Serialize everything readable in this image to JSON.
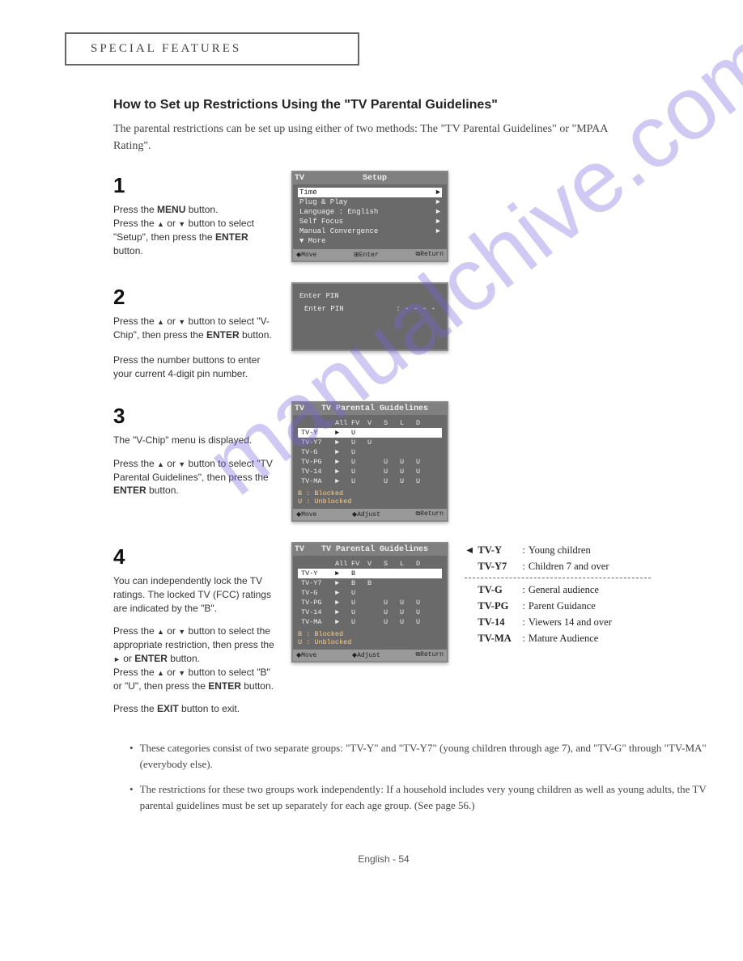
{
  "watermark": "manualchive.com",
  "section_header": "SPECIAL FEATURES",
  "main_title": "How to Set up Restrictions Using the \"TV Parental Guidelines\"",
  "intro_text": "The parental restrictions can be set up using either of two methods: The \"TV Parental Guidelines\" or \"MPAA Rating\".",
  "steps": {
    "s1": {
      "num": "1",
      "p1a": "Press the ",
      "p1b": "MENU",
      "p1c": " button.",
      "p2a": "Press the ",
      "p2b": " or ",
      "p2c": " button to select \"Setup\", then press the ",
      "p2d": "ENTER",
      "p2e": " button."
    },
    "s2": {
      "num": "2",
      "p1a": "Press the ",
      "p1b": " or ",
      "p1c": " button to select \"V-Chip\", then press the ",
      "p1d": "ENTER",
      "p1e": " button.",
      "p2": "Press the number buttons to enter your current 4-digit pin number."
    },
    "s3": {
      "num": "3",
      "p1": "The \"V-Chip\" menu is displayed.",
      "p2a": "Press the ",
      "p2b": " or ",
      "p2c": " button to select \"TV Parental Guidelines\", then press the ",
      "p2d": "ENTER",
      "p2e": " button."
    },
    "s4": {
      "num": "4",
      "p1": "You can independently lock the TV ratings. The locked TV (FCC) ratings are indicated by the \"B\".",
      "p2a": "Press the ",
      "p2b": " or ",
      "p2c": " button to select the appropriate restriction, then press  the ",
      "p2d": " or ",
      "p2e": "ENTER",
      "p2f": " button.",
      "p3a": "Press the ",
      "p3b": " or ",
      "p3c": " button to select \"B\" or \"U\", then press the ",
      "p3d": "ENTER",
      "p3e": " button.",
      "p4a": "Press the ",
      "p4b": "EXIT",
      "p4c": " button to exit."
    }
  },
  "screenshots": {
    "setup": {
      "header_tv": "TV",
      "title": "Setup",
      "rows": [
        {
          "label": "Time",
          "val": "►",
          "sel": true
        },
        {
          "label": "Plug & Play",
          "val": "►",
          "sel": false
        },
        {
          "label": "Language   :   English",
          "val": "►",
          "sel": false
        },
        {
          "label": "Self Focus",
          "val": "►",
          "sel": false
        },
        {
          "label": "Manual Convergence",
          "val": "►",
          "sel": false
        },
        {
          "label": "▼  More",
          "val": "",
          "sel": false
        }
      ],
      "footer": {
        "move": "◆Move",
        "enter": "⊞Enter",
        "return": "⧉Return"
      }
    },
    "pin": {
      "title": "Enter PIN",
      "label": "Enter PIN",
      "value": ":   - - - -"
    },
    "guidelines3": {
      "header_tv": "TV",
      "title": "TV Parental Guidelines",
      "cols": [
        "All",
        "FV",
        "V",
        "S",
        "L",
        "D"
      ],
      "rows": [
        {
          "label": "TV-Y",
          "c": [
            "►",
            "U",
            "",
            "",
            "",
            ""
          ],
          "sel": true
        },
        {
          "label": "TV-Y7",
          "c": [
            "►",
            "U",
            "U",
            "",
            "",
            ""
          ]
        },
        {
          "label": "TV-G",
          "c": [
            "►",
            "U",
            "",
            "",
            "",
            ""
          ]
        },
        {
          "label": "TV-PG",
          "c": [
            "►",
            "U",
            "",
            "U",
            "U",
            "U"
          ]
        },
        {
          "label": "TV-14",
          "c": [
            "►",
            "U",
            "",
            "U",
            "U",
            "U"
          ]
        },
        {
          "label": "TV-MA",
          "c": [
            "►",
            "U",
            "",
            "U",
            "U",
            "U"
          ]
        }
      ],
      "blocked": "B : Blocked",
      "unblocked": "U : Unblocked",
      "footer": {
        "move": "◆Move",
        "adjust": "◆Adjust",
        "return": "⧉Return"
      }
    },
    "guidelines4": {
      "header_tv": "TV",
      "title": "TV Parental Guidelines",
      "cols": [
        "All",
        "FV",
        "V",
        "S",
        "L",
        "D"
      ],
      "rows": [
        {
          "label": "TV-Y",
          "c": [
            "►",
            "B",
            "",
            "",
            "",
            ""
          ],
          "sel": true
        },
        {
          "label": "TV-Y7",
          "c": [
            "►",
            "B",
            "B",
            "",
            "",
            ""
          ]
        },
        {
          "label": "TV-G",
          "c": [
            "►",
            "U",
            "",
            "",
            "",
            ""
          ]
        },
        {
          "label": "TV-PG",
          "c": [
            "►",
            "U",
            "",
            "U",
            "U",
            "U"
          ]
        },
        {
          "label": "TV-14",
          "c": [
            "►",
            "U",
            "",
            "U",
            "U",
            "U"
          ]
        },
        {
          "label": "TV-MA",
          "c": [
            "►",
            "U",
            "",
            "U",
            "U",
            "U"
          ]
        }
      ],
      "blocked": "B : Blocked",
      "unblocked": "U : Unblocked",
      "footer": {
        "move": "◆Move",
        "adjust": "◆Adjust",
        "return": "⧉Return"
      }
    }
  },
  "legend_marker": "◄",
  "legend": [
    {
      "code": "TV-Y",
      "desc": "Young children"
    },
    {
      "code": "TV-Y7",
      "desc": "Children 7 and over"
    }
  ],
  "legend2": [
    {
      "code": "TV-G",
      "desc": "General audience"
    },
    {
      "code": "TV-PG",
      "desc": "Parent Guidance"
    },
    {
      "code": "TV-14",
      "desc": "Viewers 14 and over"
    },
    {
      "code": "TV-MA",
      "desc": "Mature Audience"
    }
  ],
  "bullets": [
    "These categories consist of two separate groups: \"TV-Y\" and \"TV-Y7\" (young children through age 7), and \"TV-G\" through \"TV-MA\" (everybody else).",
    "The restrictions for these two groups work independently: If a household includes very young children as well as young adults, the TV parental guidelines must be set up separately for each age group. (See page 56.)"
  ],
  "page_footer": "English - 54"
}
